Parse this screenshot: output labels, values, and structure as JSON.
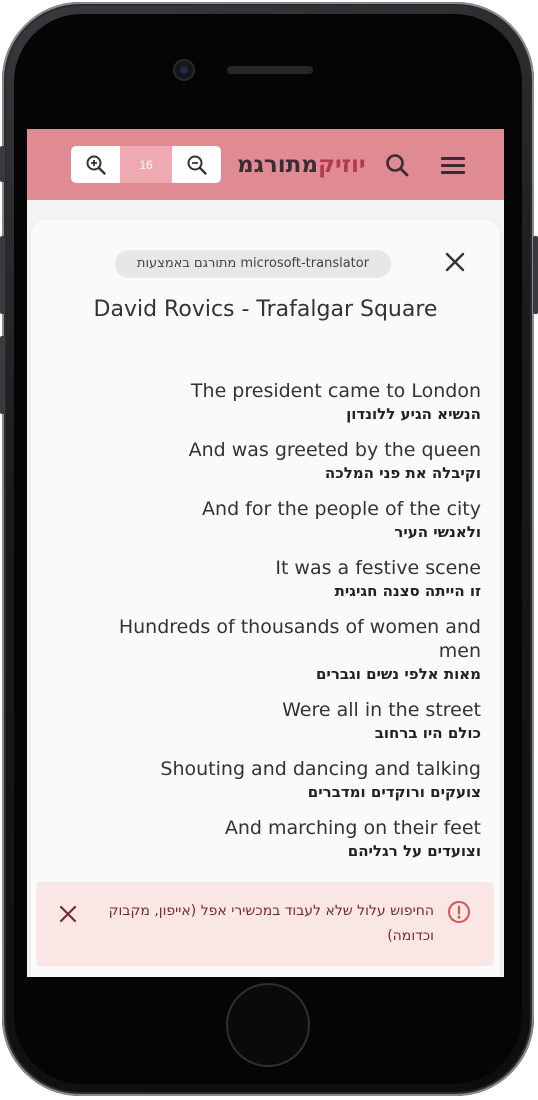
{
  "app": {
    "logo_part1": "מתורגמ",
    "logo_part2": "יוזיק",
    "font_size_value": "16"
  },
  "card": {
    "translator_badge": "מתורגם באמצעות microsoft-translator",
    "song_title": "David Rovics - Trafalgar Square"
  },
  "lyrics": [
    {
      "en": "The president came to London",
      "he": "הנשיא הגיע ללונדון"
    },
    {
      "en": "And was greeted by the queen",
      "he": "וקיבלה את פני המלכה"
    },
    {
      "en": "And for the people of the city",
      "he": "ולאנשי העיר"
    },
    {
      "en": "It was a festive scene",
      "he": "זו הייתה סצנה חגיגית"
    },
    {
      "en": "Hundreds of thousands of women and men",
      "he": "מאות אלפי נשים וגברים"
    },
    {
      "en": "Were all in the street",
      "he": "כולם היו ברחוב"
    },
    {
      "en": "Shouting and dancing and talking",
      "he": "צועקים ורוקדים ומדברים"
    },
    {
      "en": "And marching on their feet",
      "he": "וצועדים על רגליהם"
    }
  ],
  "alert": {
    "message": "החיפוש עלול שלא לעבוד במכשירי אפל (אייפון, מקבוק וכדומה)"
  },
  "colors": {
    "appbar": "#e08a93",
    "logo_accent": "#b23a4e",
    "zoom_value_bg": "#eeaab0",
    "alert_bg": "#fbe6e6",
    "alert_text": "#7a2a2a"
  }
}
